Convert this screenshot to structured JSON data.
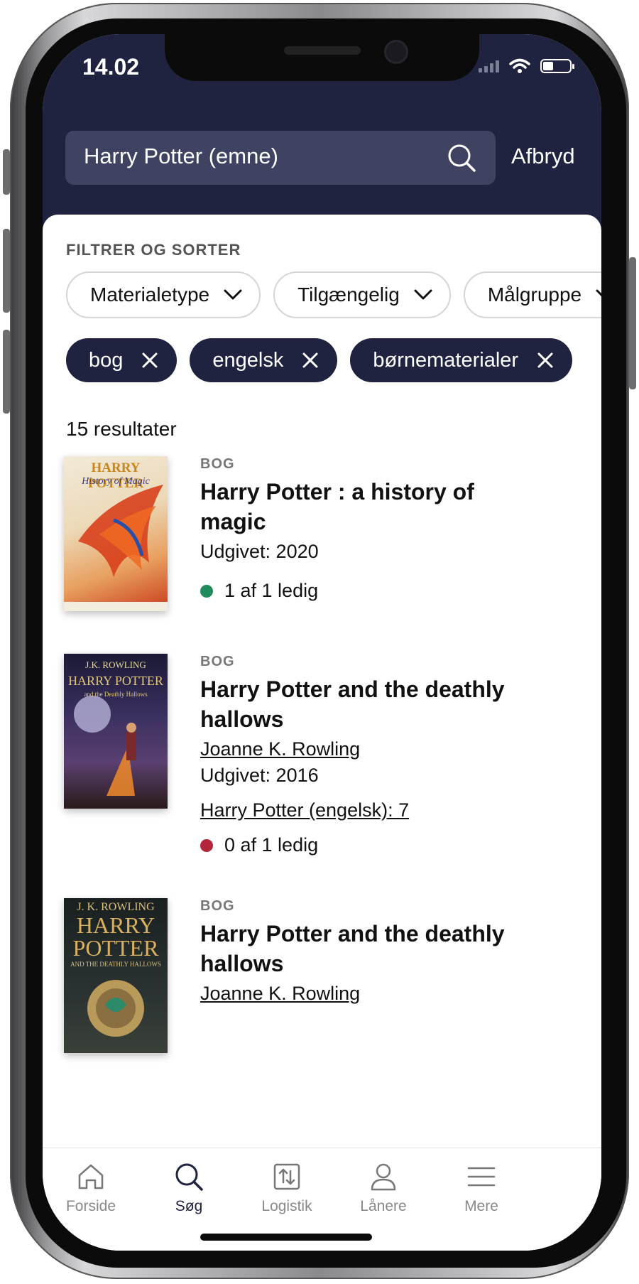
{
  "status_bar": {
    "time": "14.02"
  },
  "search": {
    "query": "Harry Potter (emne)",
    "cancel_label": "Afbryd"
  },
  "filters": {
    "heading": "FILTRER OG SORTER",
    "dropdowns": [
      {
        "label": "Materialetype"
      },
      {
        "label": "Tilgængelig"
      },
      {
        "label": "Målgruppe"
      }
    ],
    "active_tags": [
      {
        "label": "bog"
      },
      {
        "label": "engelsk"
      },
      {
        "label": "børnematerialer"
      }
    ]
  },
  "results": {
    "count_label": "15 resultater",
    "items": [
      {
        "material_type": "BOG",
        "title": "Harry Potter : a history of magic",
        "published": "Udgivet: 2020",
        "availability": "1 af 1 ledig",
        "availability_color": "#1f8a5b",
        "cover_text": [
          "HARRY POTTER",
          "History of Magic"
        ]
      },
      {
        "material_type": "BOG",
        "title": "Harry Potter and the deathly hallows",
        "author": "Joanne K. Rowling",
        "published": "Udgivet: 2016",
        "series": "Harry Potter (engelsk): 7",
        "availability": "0 af 1 ledig",
        "availability_color": "#b3263a",
        "cover_text": [
          "J.K. ROWLING",
          "HARRY POTTER",
          "and the Deathly Hallows"
        ]
      },
      {
        "material_type": "BOG",
        "title": "Harry Potter and the deathly hallows",
        "author": "Joanne K. Rowling",
        "cover_text": [
          "J. K. ROWLING",
          "HARRY",
          "POTTER",
          "AND THE DEATHLY HALLOWS"
        ]
      }
    ]
  },
  "tabbar": {
    "tabs": [
      {
        "label": "Forside",
        "icon": "home-icon"
      },
      {
        "label": "Søg",
        "icon": "search-icon",
        "active": true
      },
      {
        "label": "Logistik",
        "icon": "transfer-icon"
      },
      {
        "label": "Lånere",
        "icon": "person-icon"
      },
      {
        "label": "Mere",
        "icon": "menu-icon"
      }
    ]
  },
  "colors": {
    "header": "#1f2340",
    "search_field": "#3f4361",
    "available": "#1f8a5b",
    "unavailable": "#b3263a"
  }
}
